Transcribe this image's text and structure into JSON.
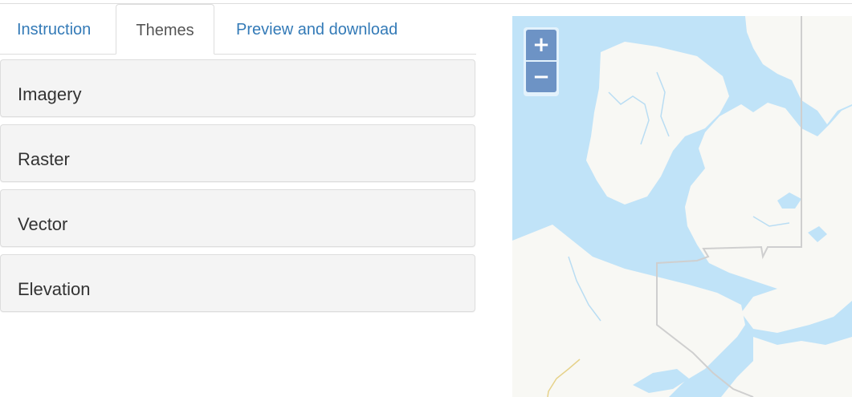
{
  "tabs": [
    {
      "label": "Instruction",
      "active": false
    },
    {
      "label": "Themes",
      "active": true
    },
    {
      "label": "Preview and download",
      "active": false
    }
  ],
  "panels": [
    {
      "title": "Imagery"
    },
    {
      "title": "Raster"
    },
    {
      "title": "Vector"
    },
    {
      "title": "Elevation"
    }
  ],
  "map": {
    "zoom_in_label": "+",
    "zoom_out_label": "−",
    "colors": {
      "water": "#c0e3f8",
      "land": "#f8f8f4",
      "boundary": "#cfcfcf",
      "road": "#e6d28a",
      "control": "#6d93c5"
    }
  }
}
